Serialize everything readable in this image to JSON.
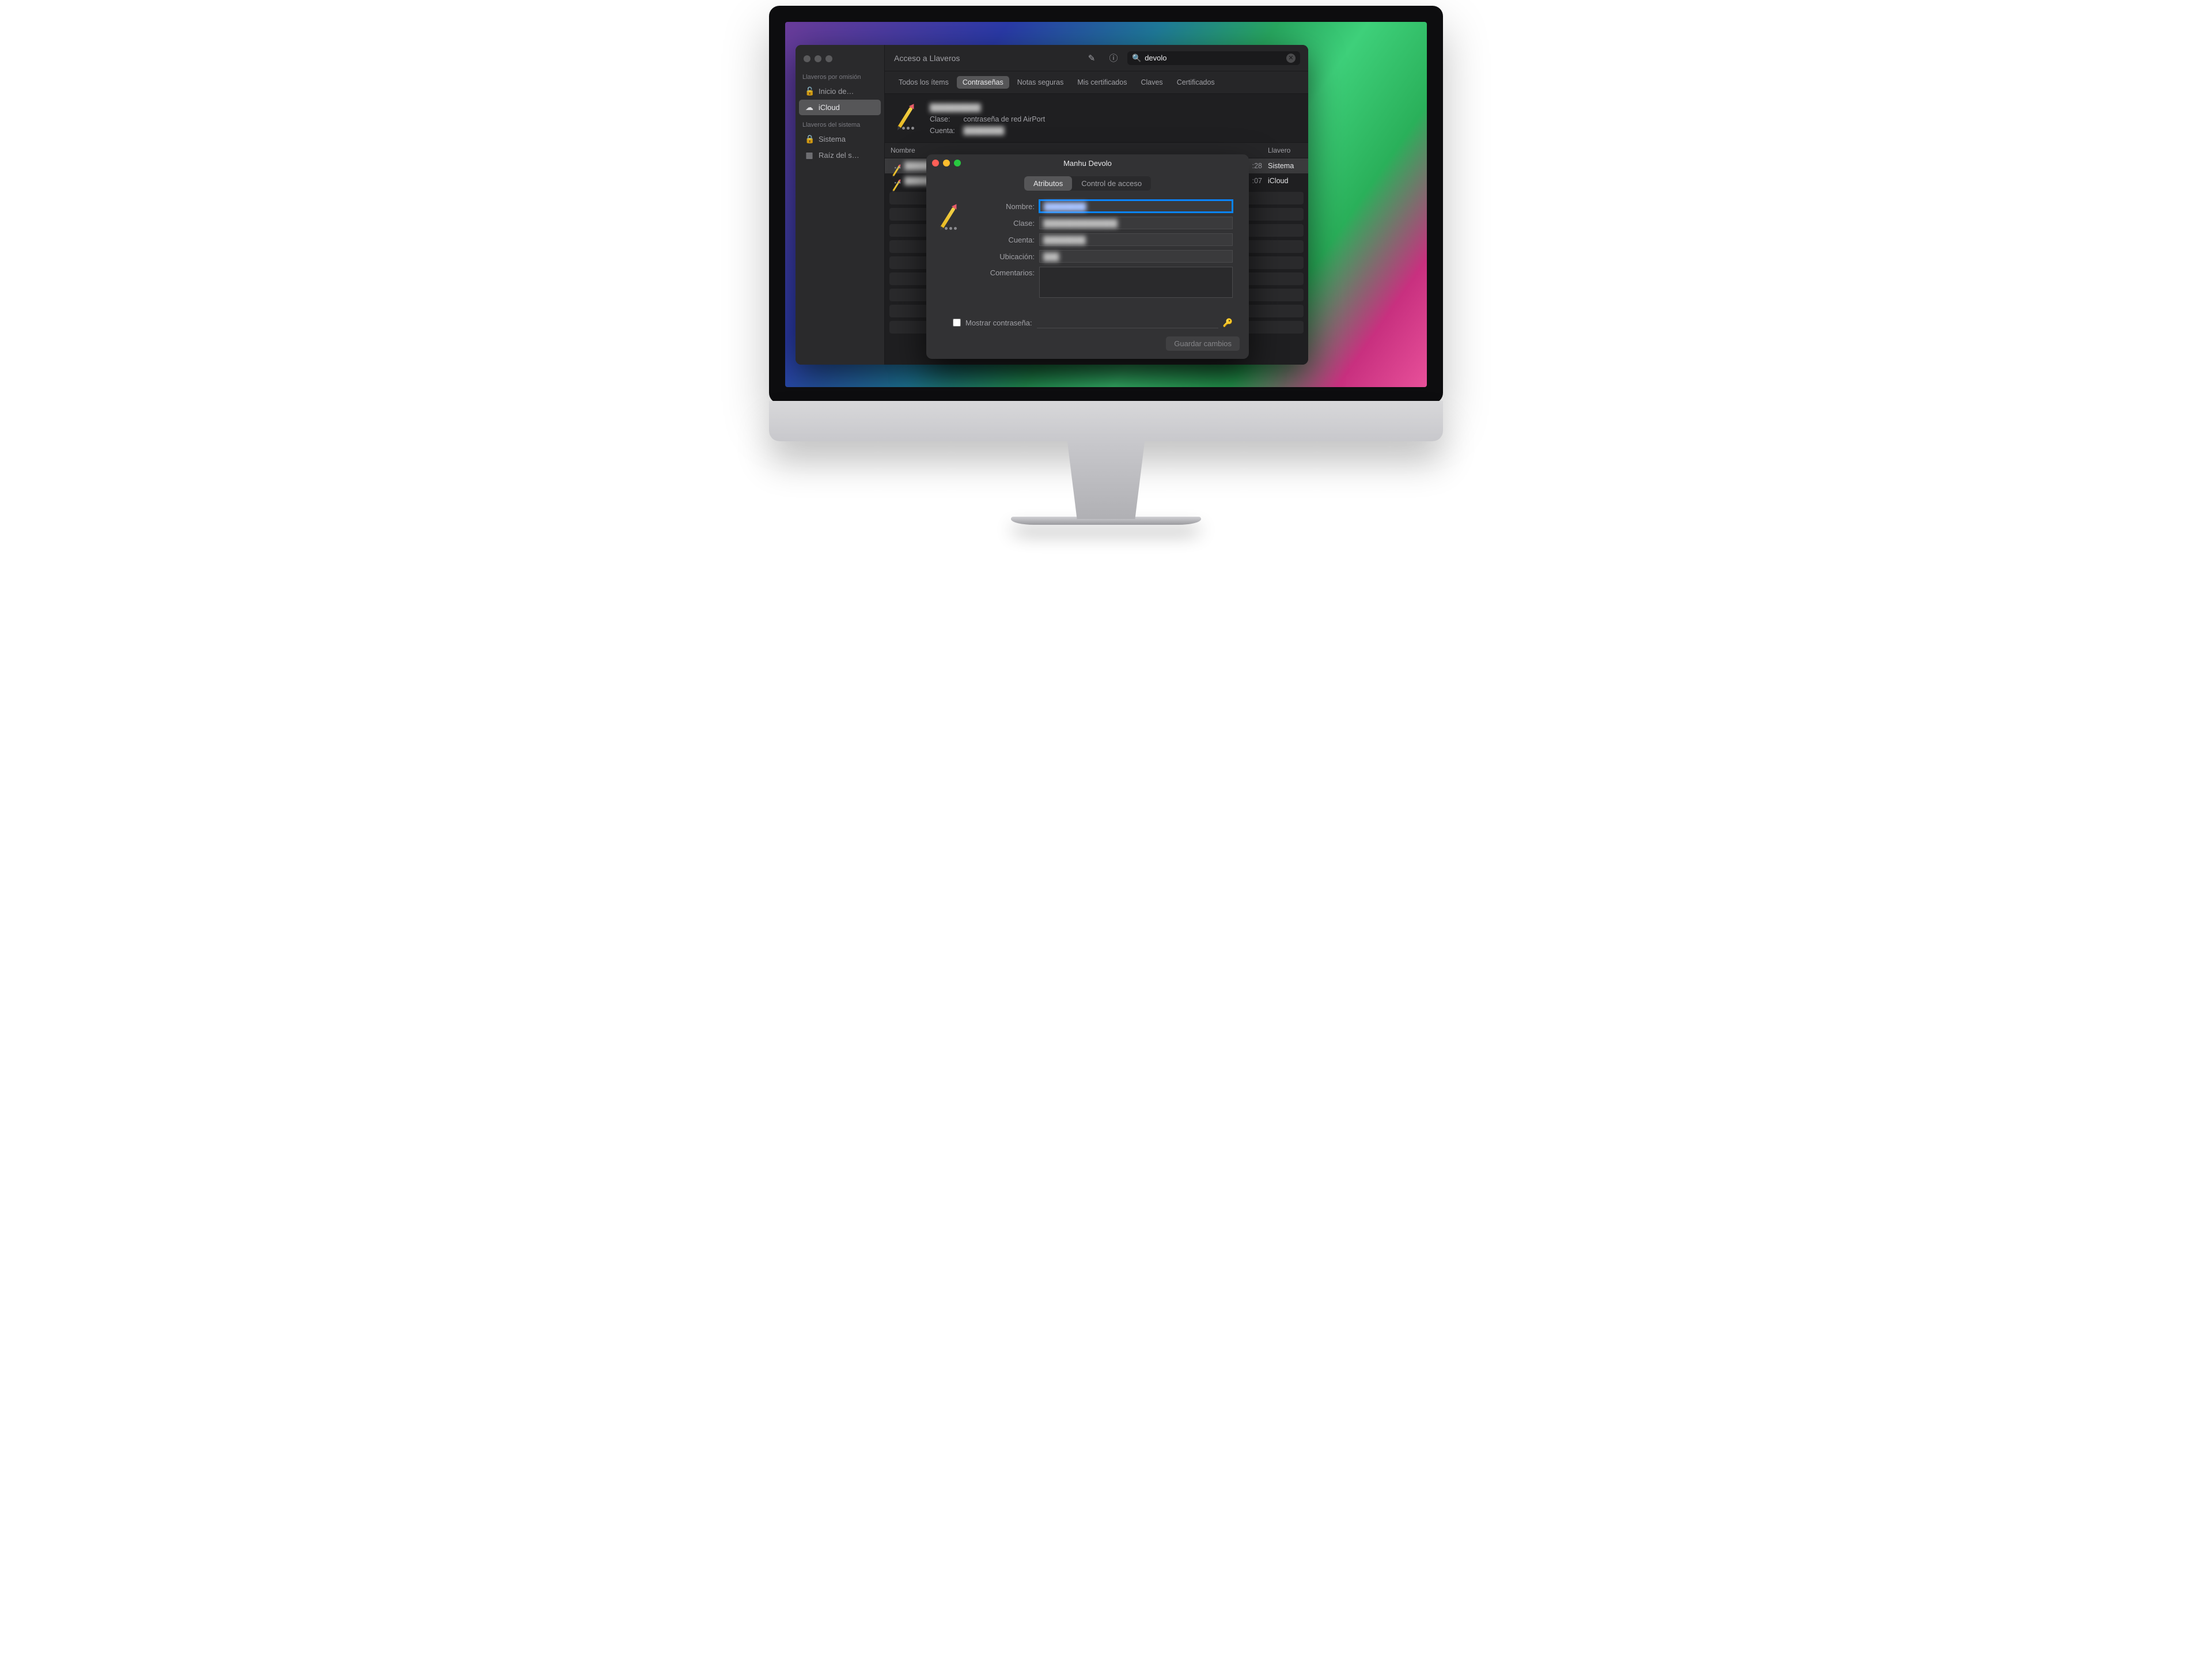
{
  "window": {
    "title": "Acceso a Llaveros",
    "search_value": "devolo"
  },
  "sidebar": {
    "section_default": "Llaveros por omisión",
    "section_system": "Llaveros del sistema",
    "items_default": [
      {
        "icon": "🔓",
        "label": "Inicio de…"
      },
      {
        "icon": "☁︎",
        "label": "iCloud",
        "selected": true
      }
    ],
    "items_system": [
      {
        "icon": "🔒",
        "label": "Sistema"
      },
      {
        "icon": "▦",
        "label": "Raíz del s…"
      }
    ]
  },
  "tabs": {
    "all": "Todos los ítems",
    "passwords": "Contraseñas",
    "notes": "Notas seguras",
    "certs": "Mis certificados",
    "keys": "Claves",
    "ca": "Certificados",
    "active": "passwords"
  },
  "detail": {
    "class_label": "Clase:",
    "class_value": "contraseña de red AirPort",
    "account_label": "Cuenta:"
  },
  "table": {
    "col_name": "Nombre",
    "col_keychain": "Llavero",
    "rows": [
      {
        "time_suffix": ":28",
        "keychain": "Sistema",
        "selected": true
      },
      {
        "time_suffix": ":07",
        "keychain": "iCloud"
      }
    ]
  },
  "sheet": {
    "title": "Manhu Devolo",
    "seg_attributes": "Atributos",
    "seg_access": "Control de acceso",
    "labels": {
      "name": "Nombre:",
      "class": "Clase:",
      "account": "Cuenta:",
      "location": "Ubicación:",
      "comments": "Comentarios:"
    },
    "show_password": "Mostrar contraseña:",
    "save": "Guardar cambios"
  }
}
